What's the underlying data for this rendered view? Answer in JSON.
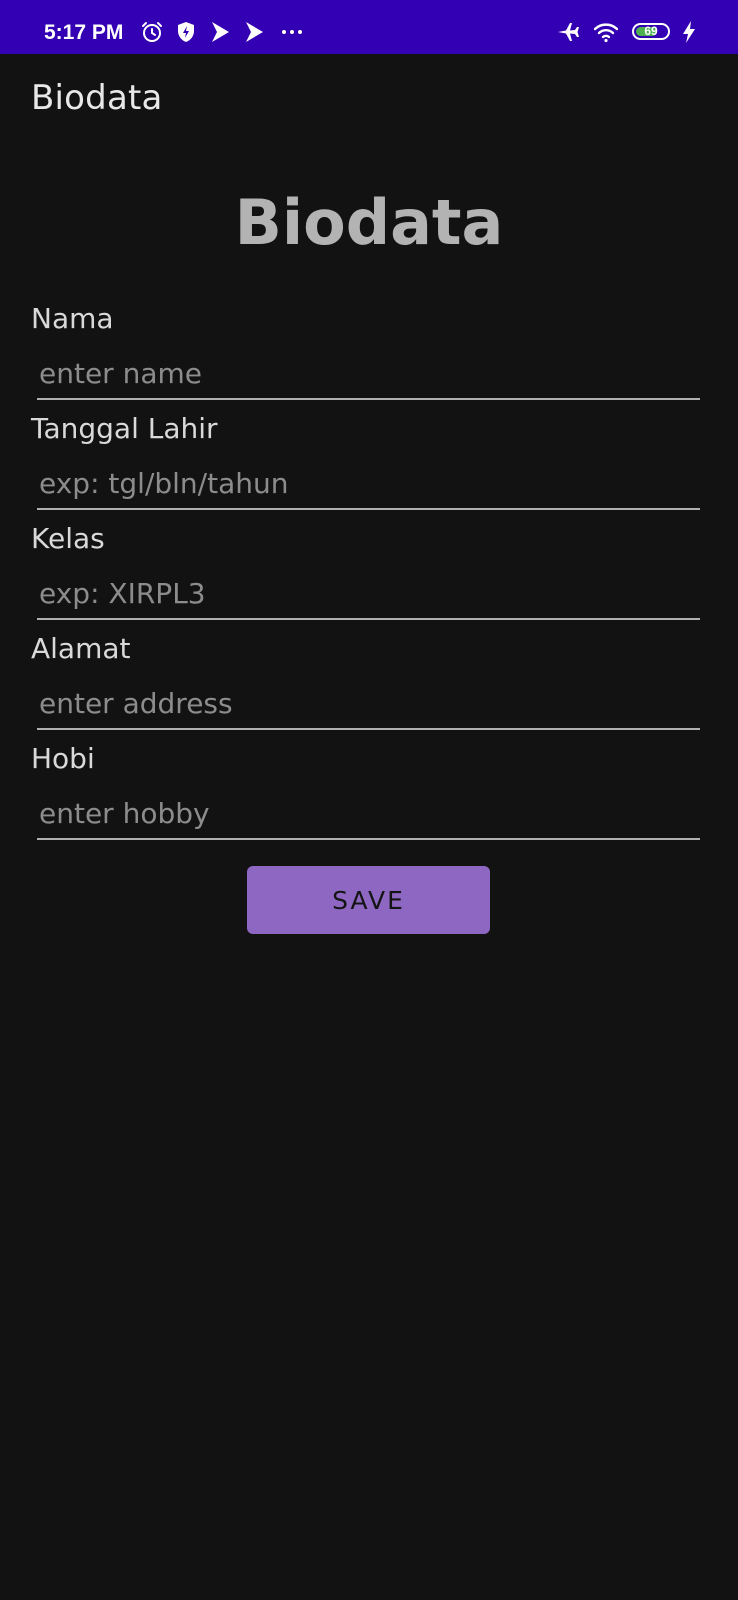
{
  "status_bar": {
    "time": "5:17 PM",
    "background": "#3300b3",
    "left_icons": [
      "alarm-icon",
      "shield-icon",
      "play-icon",
      "play-icon",
      "more-dots-icon"
    ],
    "right_icons": [
      "airplane-icon",
      "wifi-icon",
      "battery-icon",
      "charging-bolt-icon"
    ],
    "battery_level": "69",
    "battery_color": "#4caf50"
  },
  "app_bar": {
    "title": "Biodata"
  },
  "form": {
    "heading": "Biodata",
    "fields": [
      {
        "label": "Nama",
        "placeholder": "enter name",
        "value": ""
      },
      {
        "label": "Tanggal Lahir",
        "placeholder": "exp: tgl/bln/tahun",
        "value": ""
      },
      {
        "label": "Kelas",
        "placeholder": "exp: XIRPL3",
        "value": ""
      },
      {
        "label": "Alamat",
        "placeholder": "enter address",
        "value": ""
      },
      {
        "label": "Hobi",
        "placeholder": "enter hobby",
        "value": ""
      }
    ],
    "save_label": "SAVE",
    "accent_color": "#8e67c2"
  },
  "theme": {
    "background": "#121212"
  }
}
